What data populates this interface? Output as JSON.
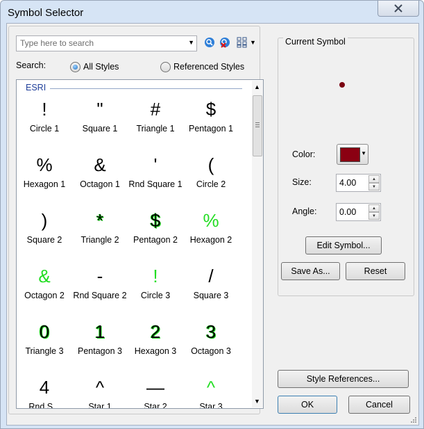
{
  "window": {
    "title": "Symbol Selector"
  },
  "search": {
    "placeholder": "Type here to search",
    "label": "Search:",
    "scope_all": "All Styles",
    "scope_referenced": "Referenced Styles",
    "selected_scope": "All Styles"
  },
  "gallery": {
    "group": "ESRI",
    "items": [
      {
        "name": "Circle 1",
        "glyph": "!",
        "style": "black"
      },
      {
        "name": "Square 1",
        "glyph": "\"",
        "style": "black"
      },
      {
        "name": "Triangle 1",
        "glyph": "#",
        "style": "black"
      },
      {
        "name": "Pentagon 1",
        "glyph": "$",
        "style": "black"
      },
      {
        "name": "Hexagon 1",
        "glyph": "%",
        "style": "black"
      },
      {
        "name": "Octagon 1",
        "glyph": "&",
        "style": "black"
      },
      {
        "name": "Rnd Square 1",
        "glyph": "'",
        "style": "black"
      },
      {
        "name": "Circle 2",
        "glyph": "(",
        "style": "black"
      },
      {
        "name": "Square 2",
        "glyph": ")",
        "style": "black"
      },
      {
        "name": "Triangle 2",
        "glyph": "*",
        "style": "mixed"
      },
      {
        "name": "Pentagon 2",
        "glyph": "$",
        "style": "mixed"
      },
      {
        "name": "Hexagon 2",
        "glyph": "%",
        "style": "green"
      },
      {
        "name": "Octagon 2",
        "glyph": "&",
        "style": "green"
      },
      {
        "name": "Rnd Square 2",
        "glyph": "-",
        "style": "black"
      },
      {
        "name": "Circle 3",
        "glyph": "!",
        "style": "green"
      },
      {
        "name": "Square 3",
        "glyph": "/",
        "style": "black"
      },
      {
        "name": "Triangle 3",
        "glyph": "0",
        "style": "mixed"
      },
      {
        "name": "Pentagon 3",
        "glyph": "1",
        "style": "mixed"
      },
      {
        "name": "Hexagon 3",
        "glyph": "2",
        "style": "mixed"
      },
      {
        "name": "Octagon 3",
        "glyph": "3",
        "style": "mixed"
      },
      {
        "name": "Rnd S...",
        "glyph": "4",
        "style": "black"
      },
      {
        "name": "Star 1",
        "glyph": "^",
        "style": "black"
      },
      {
        "name": "Star 2",
        "glyph": "—",
        "style": "black"
      },
      {
        "name": "Star 3",
        "glyph": "^",
        "style": "green"
      }
    ]
  },
  "current_symbol": {
    "title": "Current Symbol",
    "color_label": "Color:",
    "size_label": "Size:",
    "size_value": "4.00",
    "angle_label": "Angle:",
    "angle_value": "0.00",
    "color_hex": "#8b0012",
    "edit_symbol": "Edit Symbol...",
    "save_as": "Save As...",
    "reset": "Reset"
  },
  "footer": {
    "style_references": "Style References...",
    "ok": "OK",
    "cancel": "Cancel"
  },
  "colors": {
    "accent_green": "#22dd22",
    "title_blue": "#1f3f9a"
  }
}
